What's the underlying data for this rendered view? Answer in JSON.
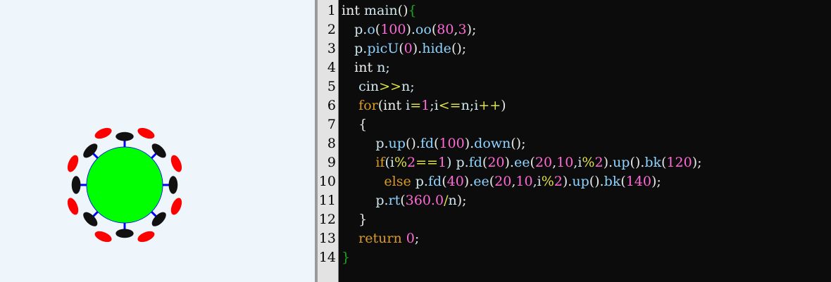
{
  "editor": {
    "language": "cpp",
    "line_numbers": [
      "1",
      "2",
      "3",
      "4",
      "5",
      "6",
      "7",
      "8",
      "9",
      "10",
      "11",
      "12",
      "13",
      "14"
    ],
    "lines": [
      [
        {
          "t": "int ",
          "c": "kw"
        },
        {
          "t": "main",
          "c": "id"
        },
        {
          "t": "()",
          "c": "pu"
        },
        {
          "t": "{",
          "c": "br"
        }
      ],
      [
        {
          "t": "   p.",
          "c": "id"
        },
        {
          "t": "o",
          "c": "fn"
        },
        {
          "t": "(",
          "c": "pu"
        },
        {
          "t": "100",
          "c": "num"
        },
        {
          "t": ").",
          "c": "pu"
        },
        {
          "t": "oo",
          "c": "fn"
        },
        {
          "t": "(",
          "c": "pu"
        },
        {
          "t": "80",
          "c": "num"
        },
        {
          "t": ",",
          "c": "pu"
        },
        {
          "t": "3",
          "c": "num"
        },
        {
          "t": ");",
          "c": "pu"
        }
      ],
      [
        {
          "t": "   p.",
          "c": "id"
        },
        {
          "t": "picU",
          "c": "fn"
        },
        {
          "t": "(",
          "c": "pu"
        },
        {
          "t": "0",
          "c": "num"
        },
        {
          "t": ").",
          "c": "pu"
        },
        {
          "t": "hide",
          "c": "fn"
        },
        {
          "t": "();",
          "c": "pu"
        }
      ],
      [
        {
          "t": "   ",
          "c": "id"
        },
        {
          "t": "int ",
          "c": "kw"
        },
        {
          "t": "n;",
          "c": "id"
        }
      ],
      [
        {
          "t": "    cin",
          "c": "id"
        },
        {
          "t": ">>",
          "c": "op"
        },
        {
          "t": "n;",
          "c": "id"
        }
      ],
      [
        {
          "t": "    ",
          "c": "id"
        },
        {
          "t": "for",
          "c": "ctl"
        },
        {
          "t": "(",
          "c": "pu"
        },
        {
          "t": "int ",
          "c": "kw"
        },
        {
          "t": "i",
          "c": "id"
        },
        {
          "t": "=",
          "c": "op"
        },
        {
          "t": "1",
          "c": "num"
        },
        {
          "t": ";i",
          "c": "id"
        },
        {
          "t": "<=",
          "c": "op"
        },
        {
          "t": "n;i",
          "c": "id"
        },
        {
          "t": "++",
          "c": "op"
        },
        {
          "t": ")",
          "c": "pu"
        }
      ],
      [
        {
          "t": "    {",
          "c": "pu"
        }
      ],
      [
        {
          "t": "        p.",
          "c": "id"
        },
        {
          "t": "up",
          "c": "fn"
        },
        {
          "t": "().",
          "c": "pu"
        },
        {
          "t": "fd",
          "c": "fn"
        },
        {
          "t": "(",
          "c": "pu"
        },
        {
          "t": "100",
          "c": "num"
        },
        {
          "t": ").",
          "c": "pu"
        },
        {
          "t": "down",
          "c": "fn"
        },
        {
          "t": "();",
          "c": "pu"
        }
      ],
      [
        {
          "t": "        ",
          "c": "id"
        },
        {
          "t": "if",
          "c": "ctl"
        },
        {
          "t": "(i",
          "c": "id"
        },
        {
          "t": "%",
          "c": "op"
        },
        {
          "t": "2",
          "c": "num"
        },
        {
          "t": "==",
          "c": "op"
        },
        {
          "t": "1",
          "c": "num"
        },
        {
          "t": ") p.",
          "c": "id"
        },
        {
          "t": "fd",
          "c": "fn"
        },
        {
          "t": "(",
          "c": "pu"
        },
        {
          "t": "20",
          "c": "num"
        },
        {
          "t": ").",
          "c": "pu"
        },
        {
          "t": "ee",
          "c": "fn"
        },
        {
          "t": "(",
          "c": "pu"
        },
        {
          "t": "20",
          "c": "num"
        },
        {
          "t": ",",
          "c": "pu"
        },
        {
          "t": "10",
          "c": "num"
        },
        {
          "t": ",i",
          "c": "id"
        },
        {
          "t": "%",
          "c": "op"
        },
        {
          "t": "2",
          "c": "num"
        },
        {
          "t": ").",
          "c": "pu"
        },
        {
          "t": "up",
          "c": "fn"
        },
        {
          "t": "().",
          "c": "pu"
        },
        {
          "t": "bk",
          "c": "fn"
        },
        {
          "t": "(",
          "c": "pu"
        },
        {
          "t": "120",
          "c": "num"
        },
        {
          "t": ");",
          "c": "pu"
        }
      ],
      [
        {
          "t": "          ",
          "c": "id"
        },
        {
          "t": "else",
          "c": "ctl"
        },
        {
          "t": " p.",
          "c": "id"
        },
        {
          "t": "fd",
          "c": "fn"
        },
        {
          "t": "(",
          "c": "pu"
        },
        {
          "t": "40",
          "c": "num"
        },
        {
          "t": ").",
          "c": "pu"
        },
        {
          "t": "ee",
          "c": "fn"
        },
        {
          "t": "(",
          "c": "pu"
        },
        {
          "t": "20",
          "c": "num"
        },
        {
          "t": ",",
          "c": "pu"
        },
        {
          "t": "10",
          "c": "num"
        },
        {
          "t": ",i",
          "c": "id"
        },
        {
          "t": "%",
          "c": "op"
        },
        {
          "t": "2",
          "c": "num"
        },
        {
          "t": ").",
          "c": "pu"
        },
        {
          "t": "up",
          "c": "fn"
        },
        {
          "t": "().",
          "c": "pu"
        },
        {
          "t": "bk",
          "c": "fn"
        },
        {
          "t": "(",
          "c": "pu"
        },
        {
          "t": "140",
          "c": "num"
        },
        {
          "t": ");",
          "c": "pu"
        }
      ],
      [
        {
          "t": "        p.",
          "c": "id"
        },
        {
          "t": "rt",
          "c": "fn"
        },
        {
          "t": "(",
          "c": "pu"
        },
        {
          "t": "360.0",
          "c": "num"
        },
        {
          "t": "/",
          "c": "op"
        },
        {
          "t": "n",
          "c": "id"
        },
        {
          "t": ");",
          "c": "pu"
        }
      ],
      [
        {
          "t": "    }",
          "c": "pu"
        }
      ],
      [
        {
          "t": "    ",
          "c": "id"
        },
        {
          "t": "return ",
          "c": "ctl"
        },
        {
          "t": "0",
          "c": "num"
        },
        {
          "t": ";",
          "c": "pu"
        }
      ],
      [
        {
          "t": "}",
          "c": "br"
        }
      ]
    ]
  },
  "canvas": {
    "description_colors": {
      "background": "#eef6fb",
      "core": "#00ff00",
      "ring": "#0000ff",
      "odd_petal": "#111111",
      "even_petal": "#ff0000"
    },
    "n": 16
  }
}
